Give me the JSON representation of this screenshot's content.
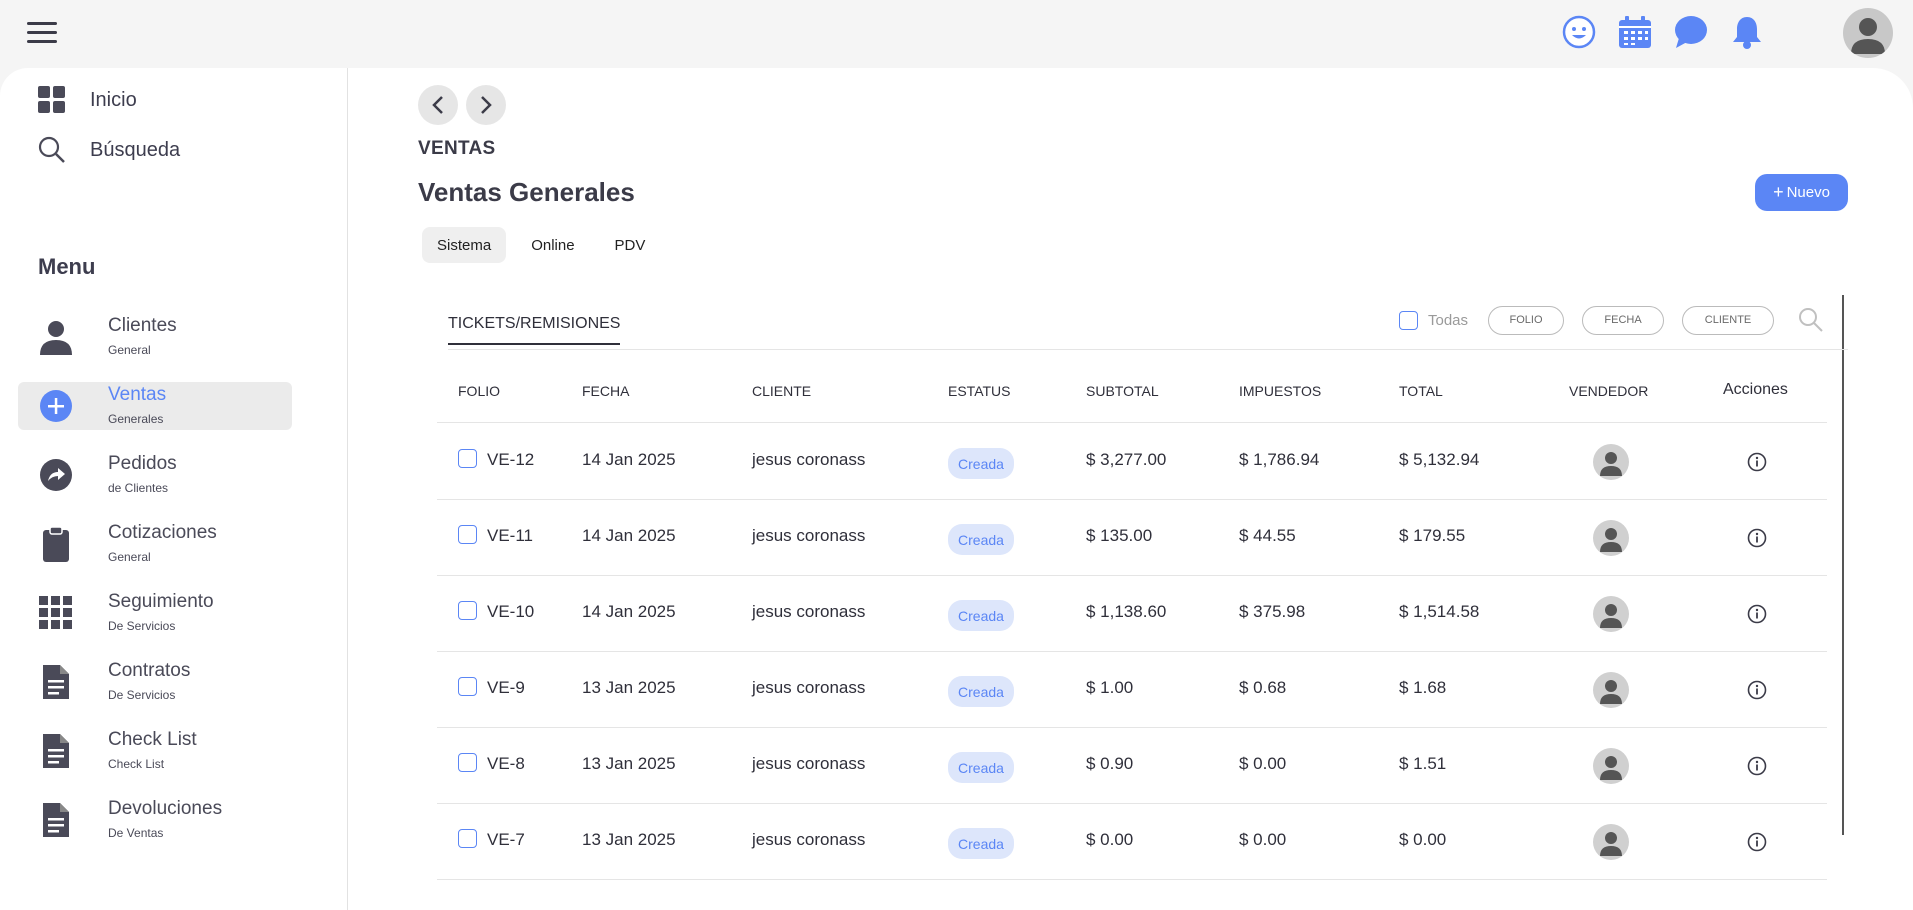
{
  "top_icons": [
    "smiley-icon",
    "calendar-icon",
    "chat-icon",
    "bell-icon"
  ],
  "accent": "#5b86f5",
  "sidebar": {
    "top_items": [
      {
        "label": "Inicio",
        "icon": "grid-icon"
      },
      {
        "label": "Búsqueda",
        "icon": "search-icon"
      }
    ],
    "menu_title": "Menu",
    "items": [
      {
        "label": "Clientes",
        "sub": "General",
        "icon": "person-icon"
      },
      {
        "label": "Ventas",
        "sub": "Generales",
        "icon": "plus-circle-icon"
      },
      {
        "label": "Pedidos",
        "sub": "de Clientes",
        "icon": "share-icon"
      },
      {
        "label": "Cotizaciones",
        "sub": "General",
        "icon": "clipboard-icon"
      },
      {
        "label": "Seguimiento",
        "sub": "De Servicios",
        "icon": "apps-icon"
      },
      {
        "label": "Contratos",
        "sub": "De Servicios",
        "icon": "document-icon"
      },
      {
        "label": "Check List",
        "sub": "Check List",
        "icon": "document-icon"
      },
      {
        "label": "Devoluciones",
        "sub": "De Ventas",
        "icon": "document-icon"
      }
    ]
  },
  "header": {
    "section": "VENTAS",
    "title": "Ventas Generales",
    "new_button": "Nuevo"
  },
  "tabs": [
    "Sistema",
    "Online",
    "PDV"
  ],
  "subtab": "TICKETS/REMISIONES",
  "filters": {
    "all_label": "Todas",
    "pills": [
      "FOLIO",
      "FECHA",
      "CLIENTE"
    ]
  },
  "table": {
    "columns": [
      "FOLIO",
      "FECHA",
      "CLIENTE",
      "ESTATUS",
      "SUBTOTAL",
      "IMPUESTOS",
      "TOTAL",
      "VENDEDOR",
      "Acciones"
    ],
    "rows": [
      {
        "folio": "VE-12",
        "fecha": "14 Jan 2025",
        "cliente": "jesus coronass",
        "estatus": "Creada",
        "subtotal": "$ 3,277.00",
        "impuestos": "$ 1,786.94",
        "total": "$ 5,132.94"
      },
      {
        "folio": "VE-11",
        "fecha": "14 Jan 2025",
        "cliente": "jesus coronass",
        "estatus": "Creada",
        "subtotal": "$ 135.00",
        "impuestos": "$ 44.55",
        "total": "$ 179.55"
      },
      {
        "folio": "VE-10",
        "fecha": "14 Jan 2025",
        "cliente": "jesus coronass",
        "estatus": "Creada",
        "subtotal": "$ 1,138.60",
        "impuestos": "$ 375.98",
        "total": "$ 1,514.58"
      },
      {
        "folio": "VE-9",
        "fecha": "13 Jan 2025",
        "cliente": "jesus coronass",
        "estatus": "Creada",
        "subtotal": "$ 1.00",
        "impuestos": "$ 0.68",
        "total": "$ 1.68"
      },
      {
        "folio": "VE-8",
        "fecha": "13 Jan 2025",
        "cliente": "jesus coronass",
        "estatus": "Creada",
        "subtotal": "$ 0.90",
        "impuestos": "$ 0.00",
        "total": "$ 1.51"
      },
      {
        "folio": "VE-7",
        "fecha": "13 Jan 2025",
        "cliente": "jesus coronass",
        "estatus": "Creada",
        "subtotal": "$ 0.00",
        "impuestos": "$ 0.00",
        "total": "$ 0.00"
      }
    ]
  }
}
